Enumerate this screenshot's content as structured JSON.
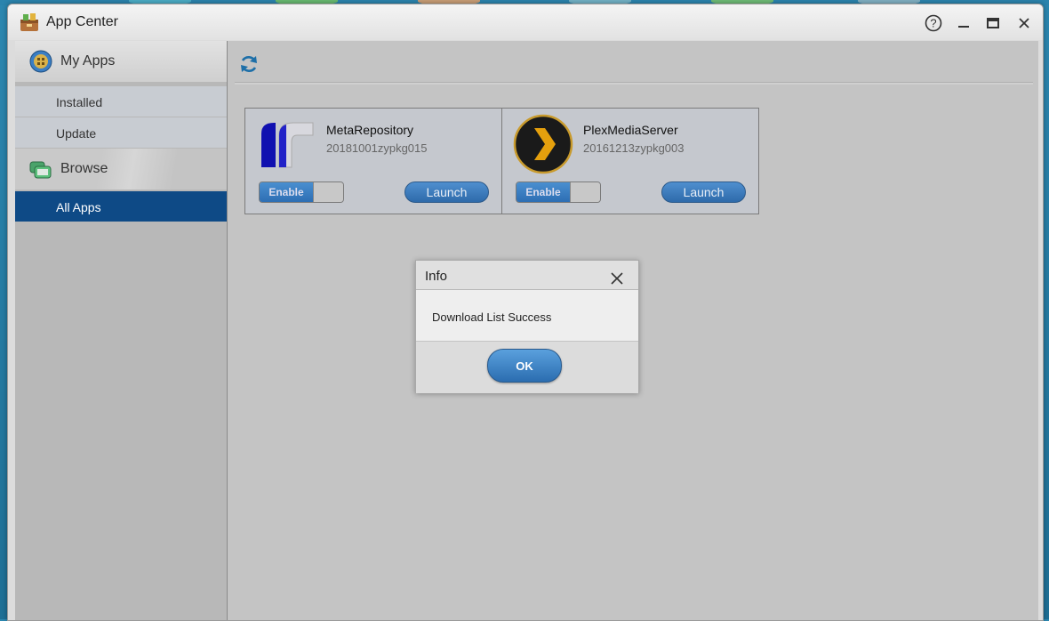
{
  "window": {
    "title": "App Center",
    "icon": "app-center-icon",
    "controls": [
      "help-icon",
      "minimize-icon",
      "maximize-icon",
      "close-icon"
    ]
  },
  "sidebar": {
    "my_apps": {
      "label": "My Apps",
      "icon": "my-apps-icon"
    },
    "my_apps_items": [
      {
        "label": "Installed"
      },
      {
        "label": "Update"
      }
    ],
    "browse": {
      "label": "Browse",
      "icon": "browse-icon"
    },
    "browse_items": [
      {
        "label": "All Apps",
        "selected": true
      }
    ]
  },
  "main": {
    "refresh_icon": "refresh-icon",
    "apps": [
      {
        "name": "MetaRepository",
        "version": "20181001zypkg015",
        "toggle_label": "Enable",
        "launch_label": "Launch"
      },
      {
        "name": "PlexMediaServer",
        "version": "20161213zypkg003",
        "toggle_label": "Enable",
        "launch_label": "Launch"
      }
    ]
  },
  "dialog": {
    "title": "Info",
    "message": "Download List Success",
    "ok_label": "OK"
  },
  "colors": {
    "sidebar_active": "#0e4a86",
    "button_blue": "#2e6aaa",
    "desktop": "#2c87b0"
  }
}
